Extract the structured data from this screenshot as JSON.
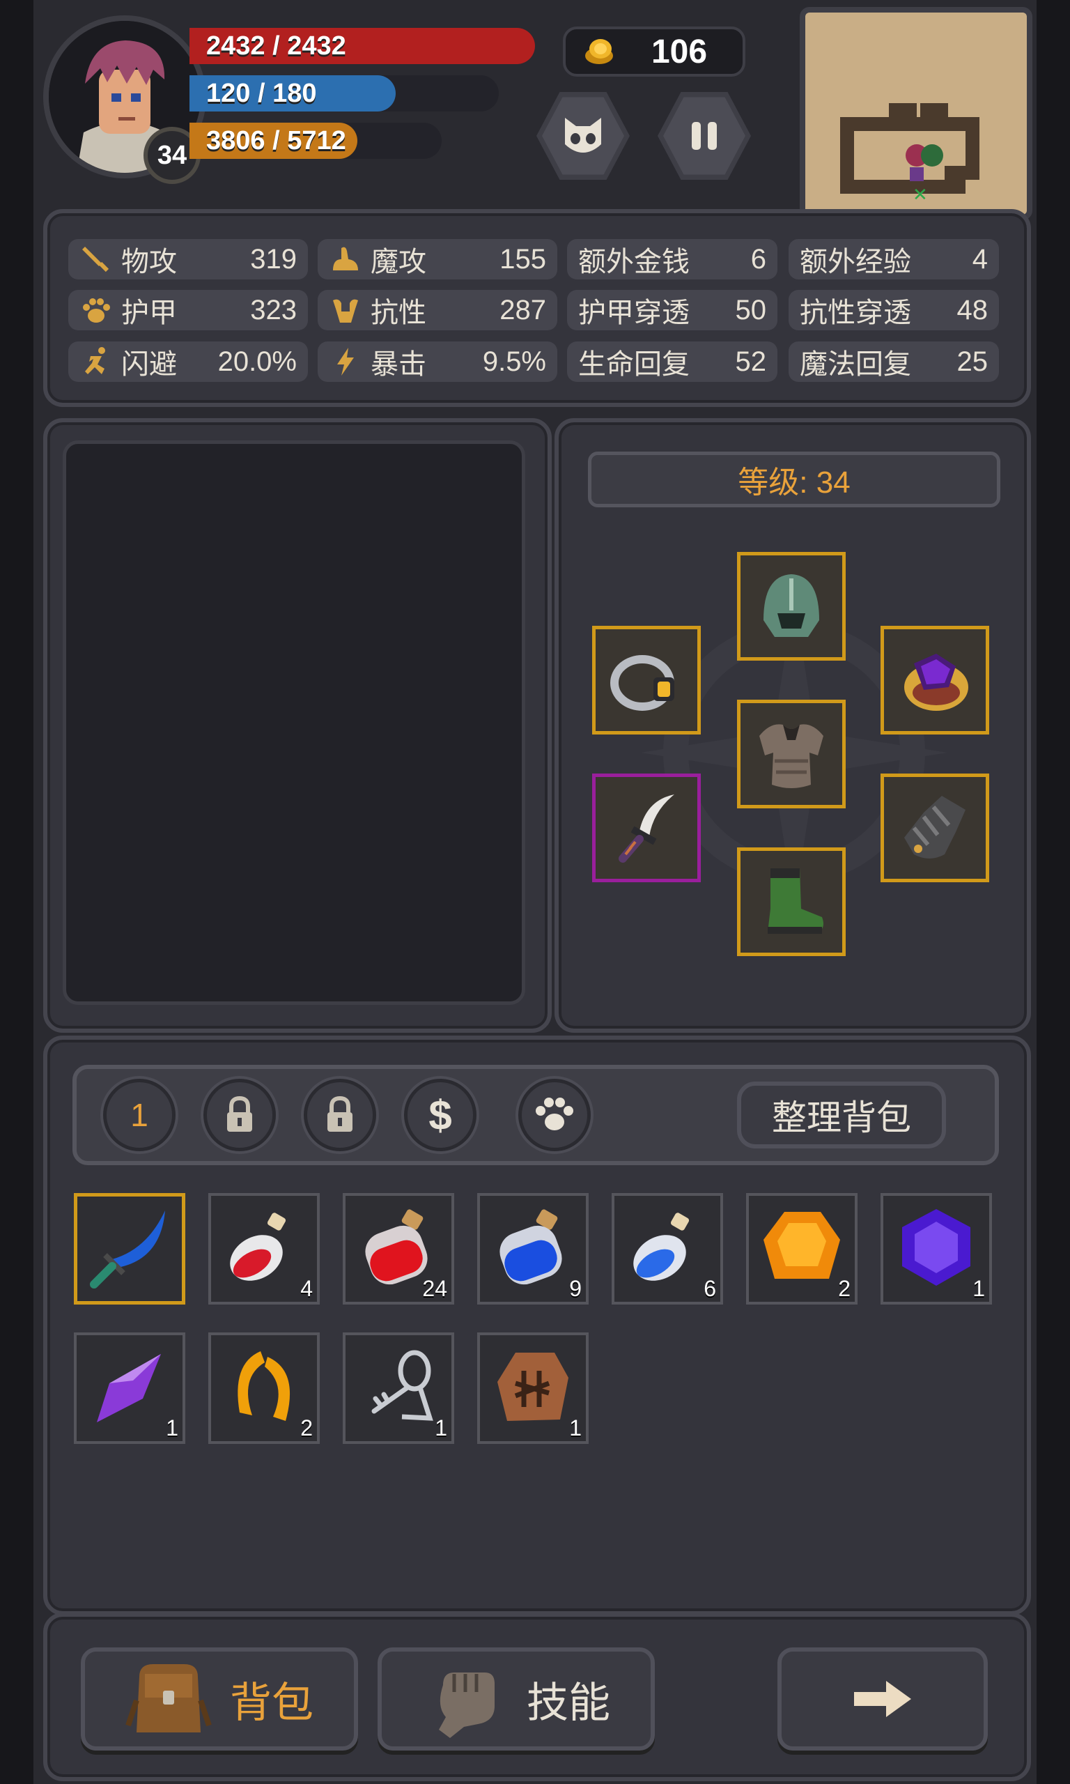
{
  "hud": {
    "level": "34",
    "hp": "2432 / 2432",
    "mp": "120 / 180",
    "xp": "3806 / 5712",
    "hp_fraction": 1.0,
    "mp_fraction": 0.667,
    "xp_fraction": 0.666,
    "gold": "106",
    "colors": {
      "hp": "#b2201f",
      "mp": "#2c6fb0",
      "xp": "#c47818",
      "accent": "#e9a23b"
    }
  },
  "stats": [
    {
      "icon": "sword-icon",
      "label": "物攻",
      "value": "319"
    },
    {
      "icon": "magic-hand-icon",
      "label": "魔攻",
      "value": "155"
    },
    {
      "icon": "",
      "label": "额外金钱",
      "value": "6"
    },
    {
      "icon": "",
      "label": "额外经验",
      "value": "4"
    },
    {
      "icon": "paw-armor-icon",
      "label": "护甲",
      "value": "323"
    },
    {
      "icon": "muscle-icon",
      "label": "抗性",
      "value": "287"
    },
    {
      "icon": "",
      "label": "护甲穿透",
      "value": "50"
    },
    {
      "icon": "",
      "label": "抗性穿透",
      "value": "48"
    },
    {
      "icon": "running-icon",
      "label": "闪避",
      "value": "20.0%"
    },
    {
      "icon": "lightning-icon",
      "label": "暴击",
      "value": "9.5%"
    },
    {
      "icon": "",
      "label": "生命回复",
      "value": "52"
    },
    {
      "icon": "",
      "label": "魔法回复",
      "value": "25"
    }
  ],
  "equipment": {
    "level_label": "等级: 34",
    "slots": [
      {
        "name": "helmet-slot",
        "icon": "helmet-icon"
      },
      {
        "name": "ring-slot",
        "icon": "ring-icon"
      },
      {
        "name": "amulet-slot",
        "icon": "gem-ring-icon"
      },
      {
        "name": "armor-slot",
        "icon": "armor-icon"
      },
      {
        "name": "weapon-slot",
        "icon": "dagger-icon"
      },
      {
        "name": "gloves-slot",
        "icon": "gauntlet-icon"
      },
      {
        "name": "boots-slot",
        "icon": "boots-icon"
      }
    ]
  },
  "bag": {
    "tab1": "1",
    "sort_label": "整理背包",
    "items": [
      {
        "icon": "curved-dagger-icon",
        "qty": ""
      },
      {
        "icon": "red-potion-small-icon",
        "qty": "4"
      },
      {
        "icon": "red-potion-large-icon",
        "qty": "24"
      },
      {
        "icon": "blue-potion-large-icon",
        "qty": "9"
      },
      {
        "icon": "blue-potion-small-icon",
        "qty": "6"
      },
      {
        "icon": "orange-gem-icon",
        "qty": "2"
      },
      {
        "icon": "purple-gem-icon",
        "qty": "1"
      },
      {
        "icon": "crystal-shard-icon",
        "qty": "1"
      },
      {
        "icon": "claw-icon",
        "qty": "2"
      },
      {
        "icon": "key-icon",
        "qty": "1"
      },
      {
        "icon": "rune-stone-icon",
        "qty": "1"
      }
    ]
  },
  "bottom": {
    "bag_label": "背包",
    "skill_label": "技能"
  }
}
